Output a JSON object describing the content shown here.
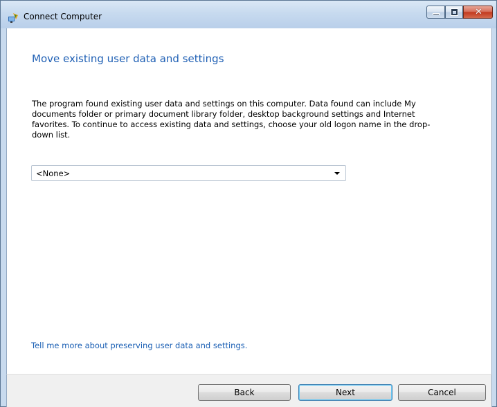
{
  "window": {
    "title": "Connect Computer"
  },
  "caption_buttons": {
    "minimize_icon": "minimize-icon",
    "maximize_icon": "maximize-icon",
    "close_icon": "close-icon",
    "close_glyph": "✕"
  },
  "page": {
    "heading": "Move existing user data and settings",
    "description": "The program found existing user data and settings on this computer. Data found can include My documents folder or primary document library folder, desktop background settings and Internet favorites. To continue to access existing data and settings, choose your old logon name in the drop-down list.",
    "logon_select": {
      "selected": "<None>"
    },
    "help_link": "Tell me more about preserving user data and settings."
  },
  "footer": {
    "back_label": "Back",
    "next_label": "Next",
    "cancel_label": "Cancel"
  },
  "colors": {
    "heading": "#1e5fb4",
    "link": "#1a5fb4",
    "close_button": "#c2391f"
  }
}
